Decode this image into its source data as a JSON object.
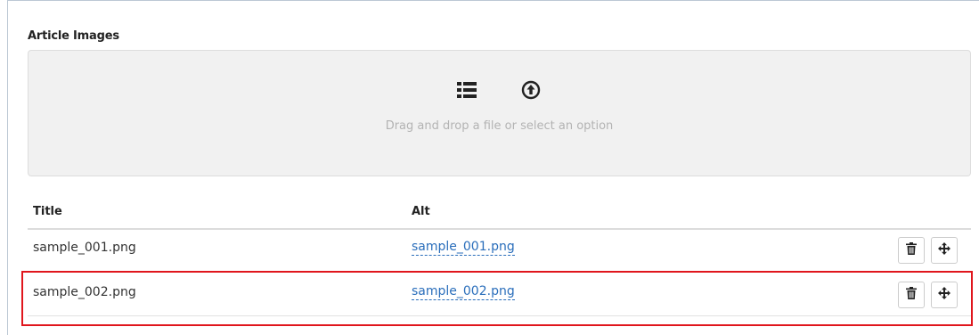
{
  "section": {
    "title": "Article Images"
  },
  "dropzone": {
    "hint": "Drag and drop a file or select an option",
    "icons": [
      "list-icon",
      "upload-circle-icon"
    ]
  },
  "table": {
    "headers": {
      "title": "Title",
      "alt": "Alt"
    },
    "rows": [
      {
        "title": "sample_001.png",
        "alt": "sample_001.png"
      },
      {
        "title": "sample_002.png",
        "alt": "sample_002.png"
      }
    ],
    "row_actions": [
      "trash-icon",
      "move-icon"
    ]
  },
  "colors": {
    "link": "#2a6ebb",
    "highlight": "#e0161d",
    "dropzone_bg": "#f1f1f1"
  },
  "highlighted_row": 2
}
